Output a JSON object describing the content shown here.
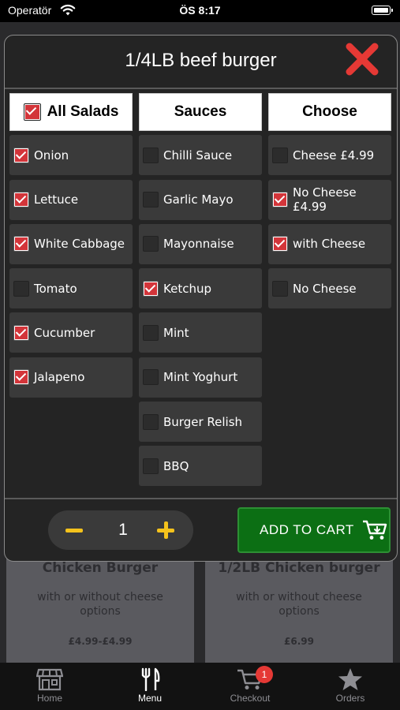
{
  "status_bar": {
    "carrier": "Operatör",
    "time": "ÖS 8:17"
  },
  "background": {
    "cards": [
      {
        "title": "Chicken Burger",
        "desc": "with or without cheese options",
        "price": "£4.99-£4.99"
      },
      {
        "title": "1/2LB Chicken burger",
        "desc": "with or without cheese options",
        "price": "£6.99"
      }
    ]
  },
  "modal": {
    "title": "1/4LB beef burger",
    "columns": [
      {
        "header": "All Salads",
        "header_checked": true,
        "options": [
          {
            "label": "Onion",
            "checked": true
          },
          {
            "label": "Lettuce",
            "checked": true
          },
          {
            "label": "White Cabbage",
            "checked": true
          },
          {
            "label": "Tomato",
            "checked": false
          },
          {
            "label": "Cucumber",
            "checked": true
          },
          {
            "label": "Jalapeno",
            "checked": true
          }
        ]
      },
      {
        "header": "Sauces",
        "options": [
          {
            "label": "Chilli Sauce",
            "checked": false
          },
          {
            "label": "Garlic Mayo",
            "checked": false
          },
          {
            "label": "Mayonnaise",
            "checked": false
          },
          {
            "label": "Ketchup",
            "checked": true
          },
          {
            "label": "Mint",
            "checked": false
          },
          {
            "label": "Mint Yoghurt",
            "checked": false
          },
          {
            "label": "Burger Relish",
            "checked": false
          },
          {
            "label": "BBQ",
            "checked": false
          }
        ]
      },
      {
        "header": "Choose",
        "options": [
          {
            "label": "Cheese £4.99",
            "checked": false
          },
          {
            "label": "No Cheese £4.99",
            "checked": true
          },
          {
            "label": "with Cheese",
            "checked": true
          },
          {
            "label": "No Cheese",
            "checked": false
          }
        ]
      }
    ],
    "quantity": "1",
    "add_to_cart_label": "ADD TO CART"
  },
  "tabbar": {
    "tabs": [
      {
        "label": "Home",
        "icon": "store-icon"
      },
      {
        "label": "Menu",
        "icon": "cutlery-icon"
      },
      {
        "label": "Checkout",
        "icon": "cart-icon"
      },
      {
        "label": "Orders",
        "icon": "star-icon"
      }
    ],
    "checkout_badge": "1"
  },
  "colors": {
    "accent_red": "#d3353a",
    "cart_green": "#0c6f14",
    "qty_yellow": "#f4c21c"
  }
}
